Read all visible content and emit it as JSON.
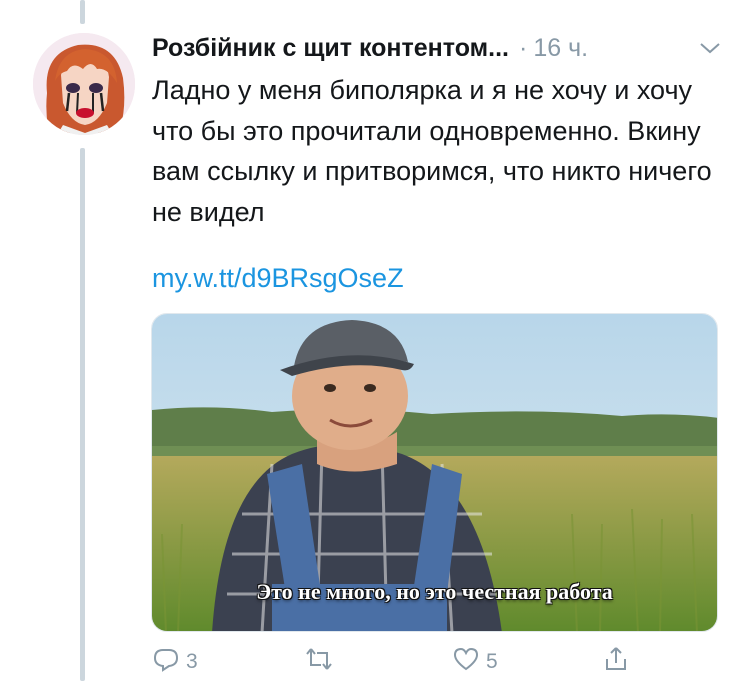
{
  "tweet": {
    "author": "Розбійник с щит контентом...",
    "separator": "·",
    "time": "16 ч.",
    "text": "Ладно у меня биполярка и я не хочу и хочу что бы это прочитали одновременно. Вкину вам ссылку и притворимся, что никто ничего не видел",
    "link": "my.w.tt/d9BRsgOseZ",
    "media_caption": "Это не много, но это честная работа"
  },
  "actions": {
    "reply_count": "3",
    "retweet_count": "",
    "like_count": "5"
  },
  "icons": {
    "menu": "chevron-down-icon",
    "reply": "reply-icon",
    "retweet": "retweet-icon",
    "like": "heart-icon",
    "share": "share-icon"
  },
  "colors": {
    "text": "#14171a",
    "secondary": "#8899a6",
    "link": "#1b95e0",
    "thread_line": "#ccd6dd"
  }
}
